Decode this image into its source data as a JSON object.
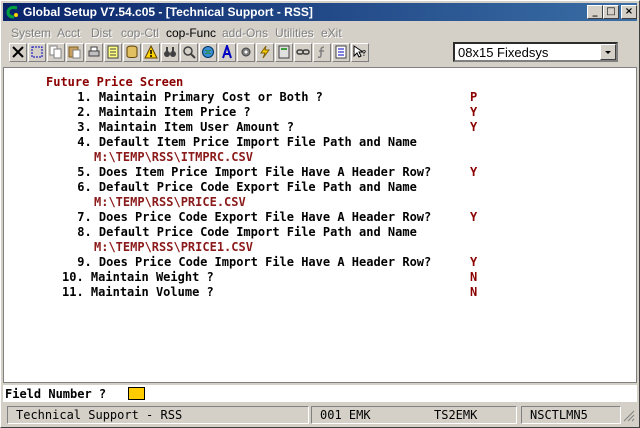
{
  "window": {
    "title": "Global Setup V7.54.c05 - [Technical Support - RSS]"
  },
  "title_buttons": {
    "minimize": "_",
    "maximize": "□",
    "close": "×"
  },
  "menu": [
    {
      "label": "System",
      "enabled": false
    },
    {
      "label": "Acct",
      "enabled": false
    },
    {
      "label": "Dist",
      "enabled": false
    },
    {
      "label": "cop-Ctl",
      "enabled": false
    },
    {
      "label": "cop-Func",
      "enabled": true
    },
    {
      "label": "add-Ons",
      "enabled": false
    },
    {
      "label": "Utilities",
      "enabled": false
    },
    {
      "label": "eXit",
      "enabled": false
    }
  ],
  "toolbar": {
    "font_value": "08x15 Fixedsys",
    "icons": [
      "close-icon",
      "select-icon",
      "copy-icon",
      "paste-icon",
      "print-icon",
      "notes-icon",
      "database-icon",
      "alert-icon",
      "binoculars-icon",
      "search-icon",
      "globe-icon",
      "font-icon",
      "settings-icon",
      "lightning-icon",
      "calculator-icon",
      "link-icon",
      "function-icon",
      "list-icon",
      "help-cursor-icon"
    ]
  },
  "screen": {
    "heading": "Future Price Screen",
    "items": [
      {
        "num": " 1.",
        "label": "Maintain Primary Cost or Both ?",
        "value": "P"
      },
      {
        "num": " 2.",
        "label": "Maintain Item Price ?",
        "value": "Y"
      },
      {
        "num": " 3.",
        "label": "Maintain Item User Amount ?",
        "value": "Y"
      },
      {
        "num": " 4.",
        "label": "Default Item Price Import File Path and Name",
        "path": "M:\\TEMP\\RSS\\ITMPRC.CSV"
      },
      {
        "num": " 5.",
        "label": "Does Item Price Import File Have A Header Row?",
        "value": "Y"
      },
      {
        "num": " 6.",
        "label": "Default Price Code Export File Path and Name",
        "path": "M:\\TEMP\\RSS\\PRICE.CSV"
      },
      {
        "num": " 7.",
        "label": "Does Price Code Export File Have A Header Row?",
        "value": "Y"
      },
      {
        "num": " 8.",
        "label": "Default Price Code Import File Path and Name",
        "path": "M:\\TEMP\\RSS\\PRICE1.CSV"
      },
      {
        "num": " 9.",
        "label": "Does Price Code Import File Have A Header Row?",
        "value": "Y"
      },
      {
        "num": "10.",
        "label": "Maintain Weight ?",
        "value": "N"
      },
      {
        "num": "11.",
        "label": "Maintain Volume ?",
        "value": "N"
      }
    ]
  },
  "prompt": {
    "label": "Field Number ?"
  },
  "status": {
    "company": "Technical Support - RSS",
    "user_code": "001 EMK",
    "terminal": "TS2EMK",
    "program": "NSCTLMN5"
  }
}
